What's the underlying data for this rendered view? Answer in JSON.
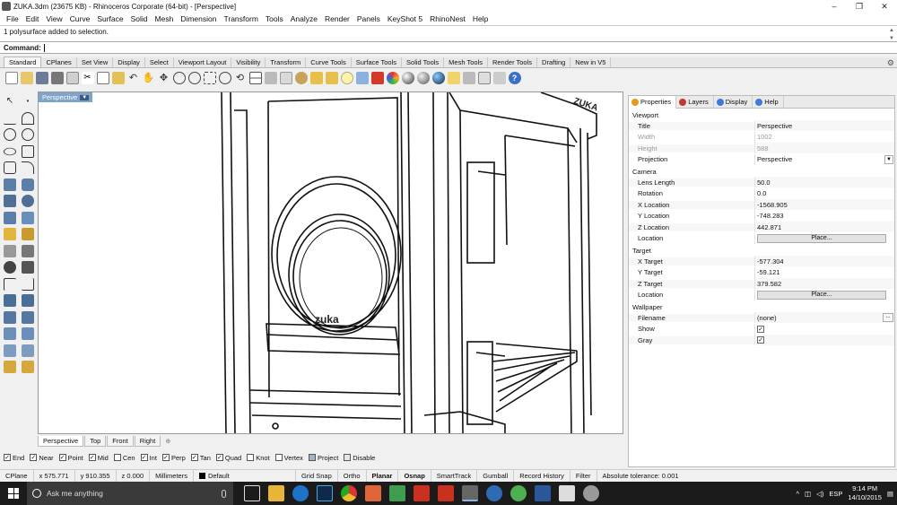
{
  "window": {
    "title": "ZUKA.3dm (23675 KB) - Rhinoceros Corporate (64-bit) - [Perspective]",
    "controls": [
      "–",
      "❐",
      "✕"
    ]
  },
  "menu": [
    "File",
    "Edit",
    "View",
    "Curve",
    "Surface",
    "Solid",
    "Mesh",
    "Dimension",
    "Transform",
    "Tools",
    "Analyze",
    "Render",
    "Panels",
    "KeyShot 5",
    "RhinoNest",
    "Help"
  ],
  "command": {
    "history": "1 polysurface added to selection.",
    "prompt": "Command:"
  },
  "toolbar_tabs": [
    "Standard",
    "CPlanes",
    "Set View",
    "Display",
    "Select",
    "Viewport Layout",
    "Visibility",
    "Transform",
    "Curve Tools",
    "Surface Tools",
    "Solid Tools",
    "Mesh Tools",
    "Render Tools",
    "Drafting",
    "New in V5"
  ],
  "toolbar_icons": [
    "new-icon",
    "open-icon",
    "save-icon",
    "print-icon",
    "import-icon",
    "cut-icon",
    "copy-icon",
    "paste-icon",
    "undo-icon",
    "pan-icon",
    "move-icon",
    "zoom-dynamic-icon",
    "zoom-window-icon",
    "zoom-extents-icon",
    "zoom-selected-icon",
    "rotate-view-icon",
    "four-views-icon",
    "cplane-icon",
    "grid-icon",
    "hide-icon",
    "lock-icon",
    "unlock-icon",
    "lightbulb-icon",
    "layer-icon",
    "properties-icon",
    "material-icon",
    "render-preview-icon",
    "environment-icon",
    "sun-icon",
    "render-icon",
    "keyshot-icon",
    "drafting-icon",
    "options-icon",
    "help-icon"
  ],
  "viewport": {
    "label": "Perspective",
    "tabs": [
      "Perspective",
      "Top",
      "Front",
      "Right"
    ],
    "logo_text": "zuka",
    "corner_text": "ZUKA"
  },
  "panel": {
    "tabs": [
      {
        "label": "Properties",
        "color": "#e09b1a"
      },
      {
        "label": "Layers",
        "color": "#c0392b"
      },
      {
        "label": "Display",
        "color": "#3d7bd9"
      },
      {
        "label": "Help",
        "color": "#3d7bd9"
      }
    ],
    "sections": {
      "viewport": "Viewport",
      "camera": "Camera",
      "target": "Target",
      "wallpaper": "Wallpaper"
    },
    "viewport_rows": [
      {
        "label": "Title",
        "value": "Perspective"
      },
      {
        "label": "Width",
        "value": "1002"
      },
      {
        "label": "Height",
        "value": "588"
      },
      {
        "label": "Projection",
        "value": "Perspective"
      }
    ],
    "camera_rows": [
      {
        "label": "Lens Length",
        "value": "50.0"
      },
      {
        "label": "Rotation",
        "value": "0.0"
      },
      {
        "label": "X Location",
        "value": "-1568.905"
      },
      {
        "label": "Y Location",
        "value": "-748.283"
      },
      {
        "label": "Z Location",
        "value": "442.871"
      },
      {
        "label": "Location",
        "value": "Place..."
      }
    ],
    "target_rows": [
      {
        "label": "X Target",
        "value": "-577.304"
      },
      {
        "label": "Y Target",
        "value": "-59.121"
      },
      {
        "label": "Z Target",
        "value": "379.582"
      },
      {
        "label": "Location",
        "value": "Place..."
      }
    ],
    "wallpaper_rows": [
      {
        "label": "Filename",
        "value": "(none)"
      },
      {
        "label": "Show",
        "value": "✓"
      },
      {
        "label": "Gray",
        "value": "✓"
      }
    ]
  },
  "osnaps": [
    {
      "label": "End",
      "checked": "✓"
    },
    {
      "label": "Near",
      "checked": "✓"
    },
    {
      "label": "Point",
      "checked": "✓"
    },
    {
      "label": "Mid",
      "checked": "✓"
    },
    {
      "label": "Cen",
      "checked": ""
    },
    {
      "label": "Int",
      "checked": "✓"
    },
    {
      "label": "Perp",
      "checked": "✓"
    },
    {
      "label": "Tan",
      "checked": "✓"
    },
    {
      "label": "Quad",
      "checked": "✓"
    },
    {
      "label": "Knot",
      "checked": ""
    },
    {
      "label": "Vertex",
      "checked": ""
    },
    {
      "label": "Project",
      "checked": ""
    },
    {
      "label": "Disable",
      "checked": ""
    }
  ],
  "status": {
    "cplane": "CPlane",
    "x": "x 575.771",
    "y": "y 910.355",
    "z": "z 0.000",
    "units": "Millimeters",
    "layer": "Default",
    "grid_snap": "Grid Snap",
    "ortho": "Ortho",
    "planar": "Planar",
    "osnap": "Osnap",
    "smarttrack": "SmartTrack",
    "gumball": "Gumball",
    "record_history": "Record History",
    "filter": "Filter",
    "tolerance": "Absolute tolerance: 0.001"
  },
  "taskbar": {
    "search_placeholder": "Ask me anything",
    "time": "9:14 PM",
    "date": "14/10/2015",
    "lang": "ESP"
  }
}
